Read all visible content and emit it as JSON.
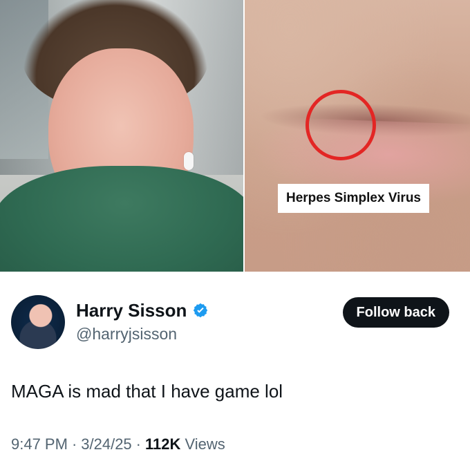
{
  "media": {
    "left_image_alt": "",
    "right_image_caption": "Herpes Simplex Virus",
    "highlight_color": "#e32624"
  },
  "tweet": {
    "author": {
      "display_name": "Harry Sisson",
      "handle": "@harryjsisson",
      "verified": true,
      "verified_color": "#1d9bf0"
    },
    "follow_button_label": "Follow back",
    "text": "MAGA is mad that I have game lol",
    "time": "9:47 PM",
    "date": "3/24/25",
    "views_count": "112K",
    "views_label": "Views"
  }
}
